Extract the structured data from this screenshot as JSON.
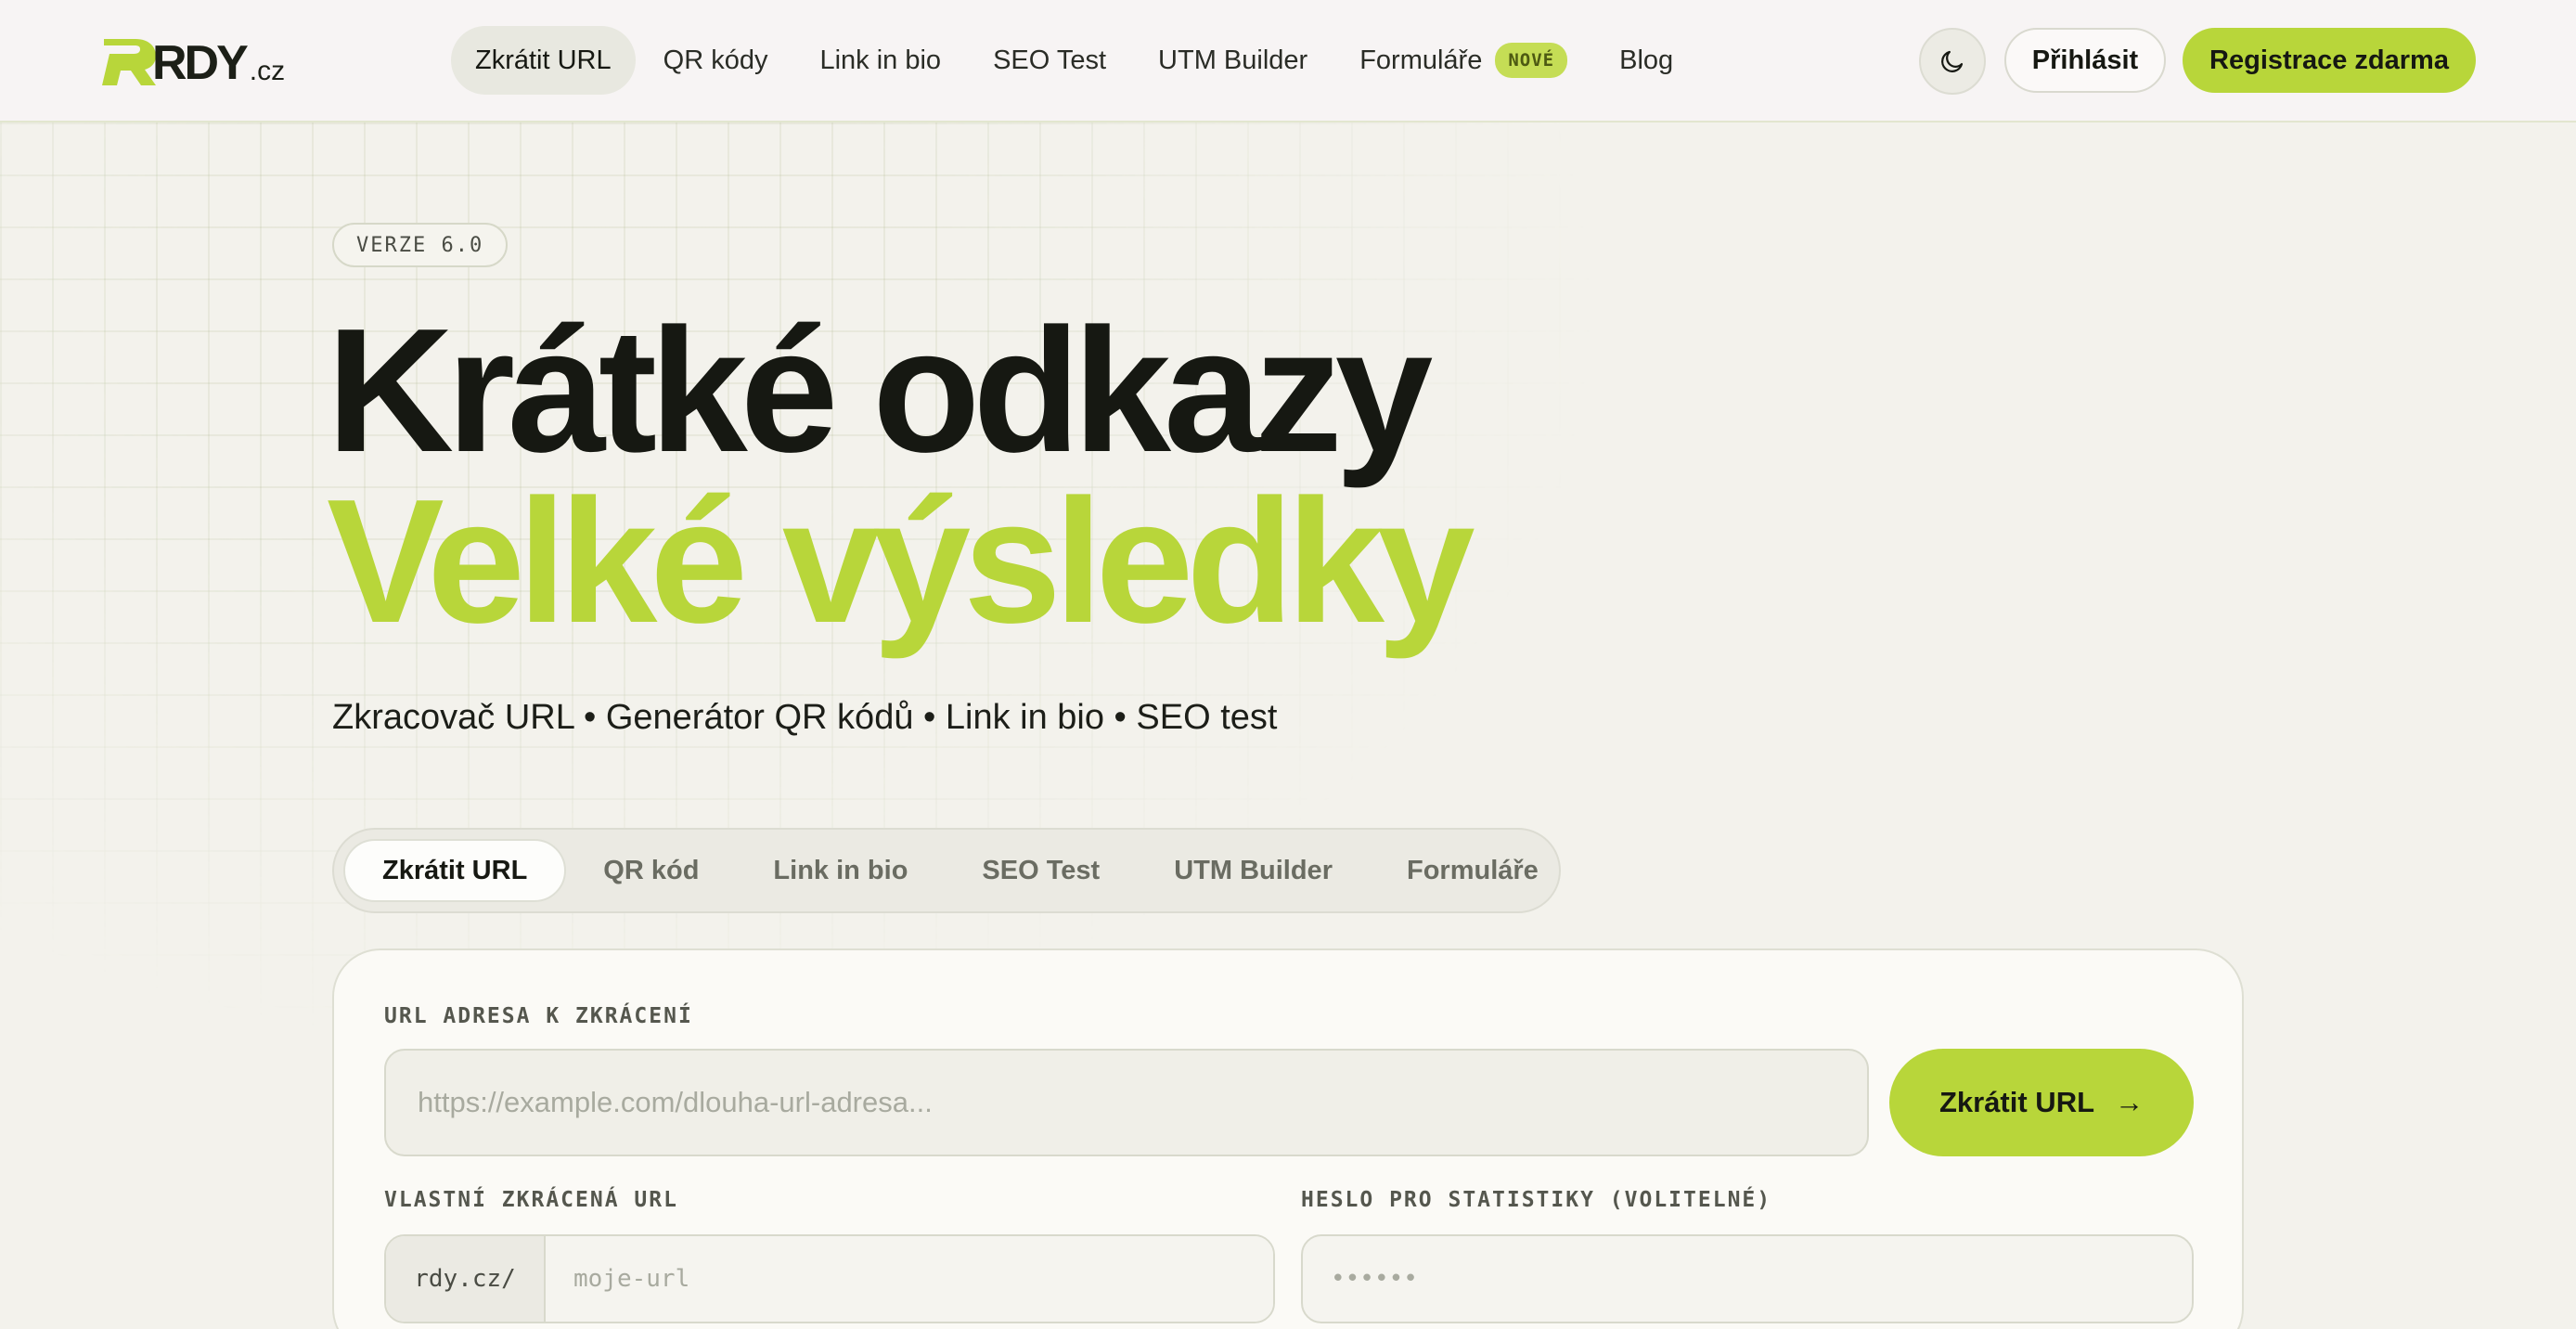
{
  "brand": {
    "logo_text": "RDY",
    "logo_suffix": ".cz",
    "accent_color": "#b8d63a"
  },
  "nav": {
    "items": [
      {
        "label": "Zkrátit URL",
        "active": true
      },
      {
        "label": "QR kódy"
      },
      {
        "label": "Link in bio"
      },
      {
        "label": "SEO Test"
      },
      {
        "label": "UTM Builder"
      },
      {
        "label": "Formuláře",
        "badge": "NOVÉ"
      },
      {
        "label": "Blog"
      }
    ],
    "theme_toggle_icon": "moon-icon",
    "login_label": "Přihlásit",
    "signup_label": "Registrace zdarma"
  },
  "hero": {
    "version": "VERZE 6.0",
    "title_line1": "Krátké odkazy",
    "title_line2": "Velké výsledky",
    "subtitle": "Zkracovač URL • Generátor QR kódů • Link in bio • SEO test"
  },
  "tabs": [
    {
      "label": "Zkrátit URL",
      "active": true
    },
    {
      "label": "QR kód"
    },
    {
      "label": "Link in bio"
    },
    {
      "label": "SEO Test"
    },
    {
      "label": "UTM Builder"
    },
    {
      "label": "Formuláře"
    }
  ],
  "form": {
    "url_label": "URL ADRESA K ZKRÁCENÍ",
    "url_placeholder": "https://example.com/dlouha-url-adresa...",
    "submit_label": "Zkrátit URL",
    "submit_arrow": "→",
    "custom_label": "VLASTNÍ ZKRÁCENÁ URL",
    "custom_prefix": "rdy.cz/",
    "custom_placeholder": "moje-url",
    "password_label": "HESLO PRO STATISTIKY (VOLITELNÉ)",
    "password_placeholder": "••••••"
  }
}
